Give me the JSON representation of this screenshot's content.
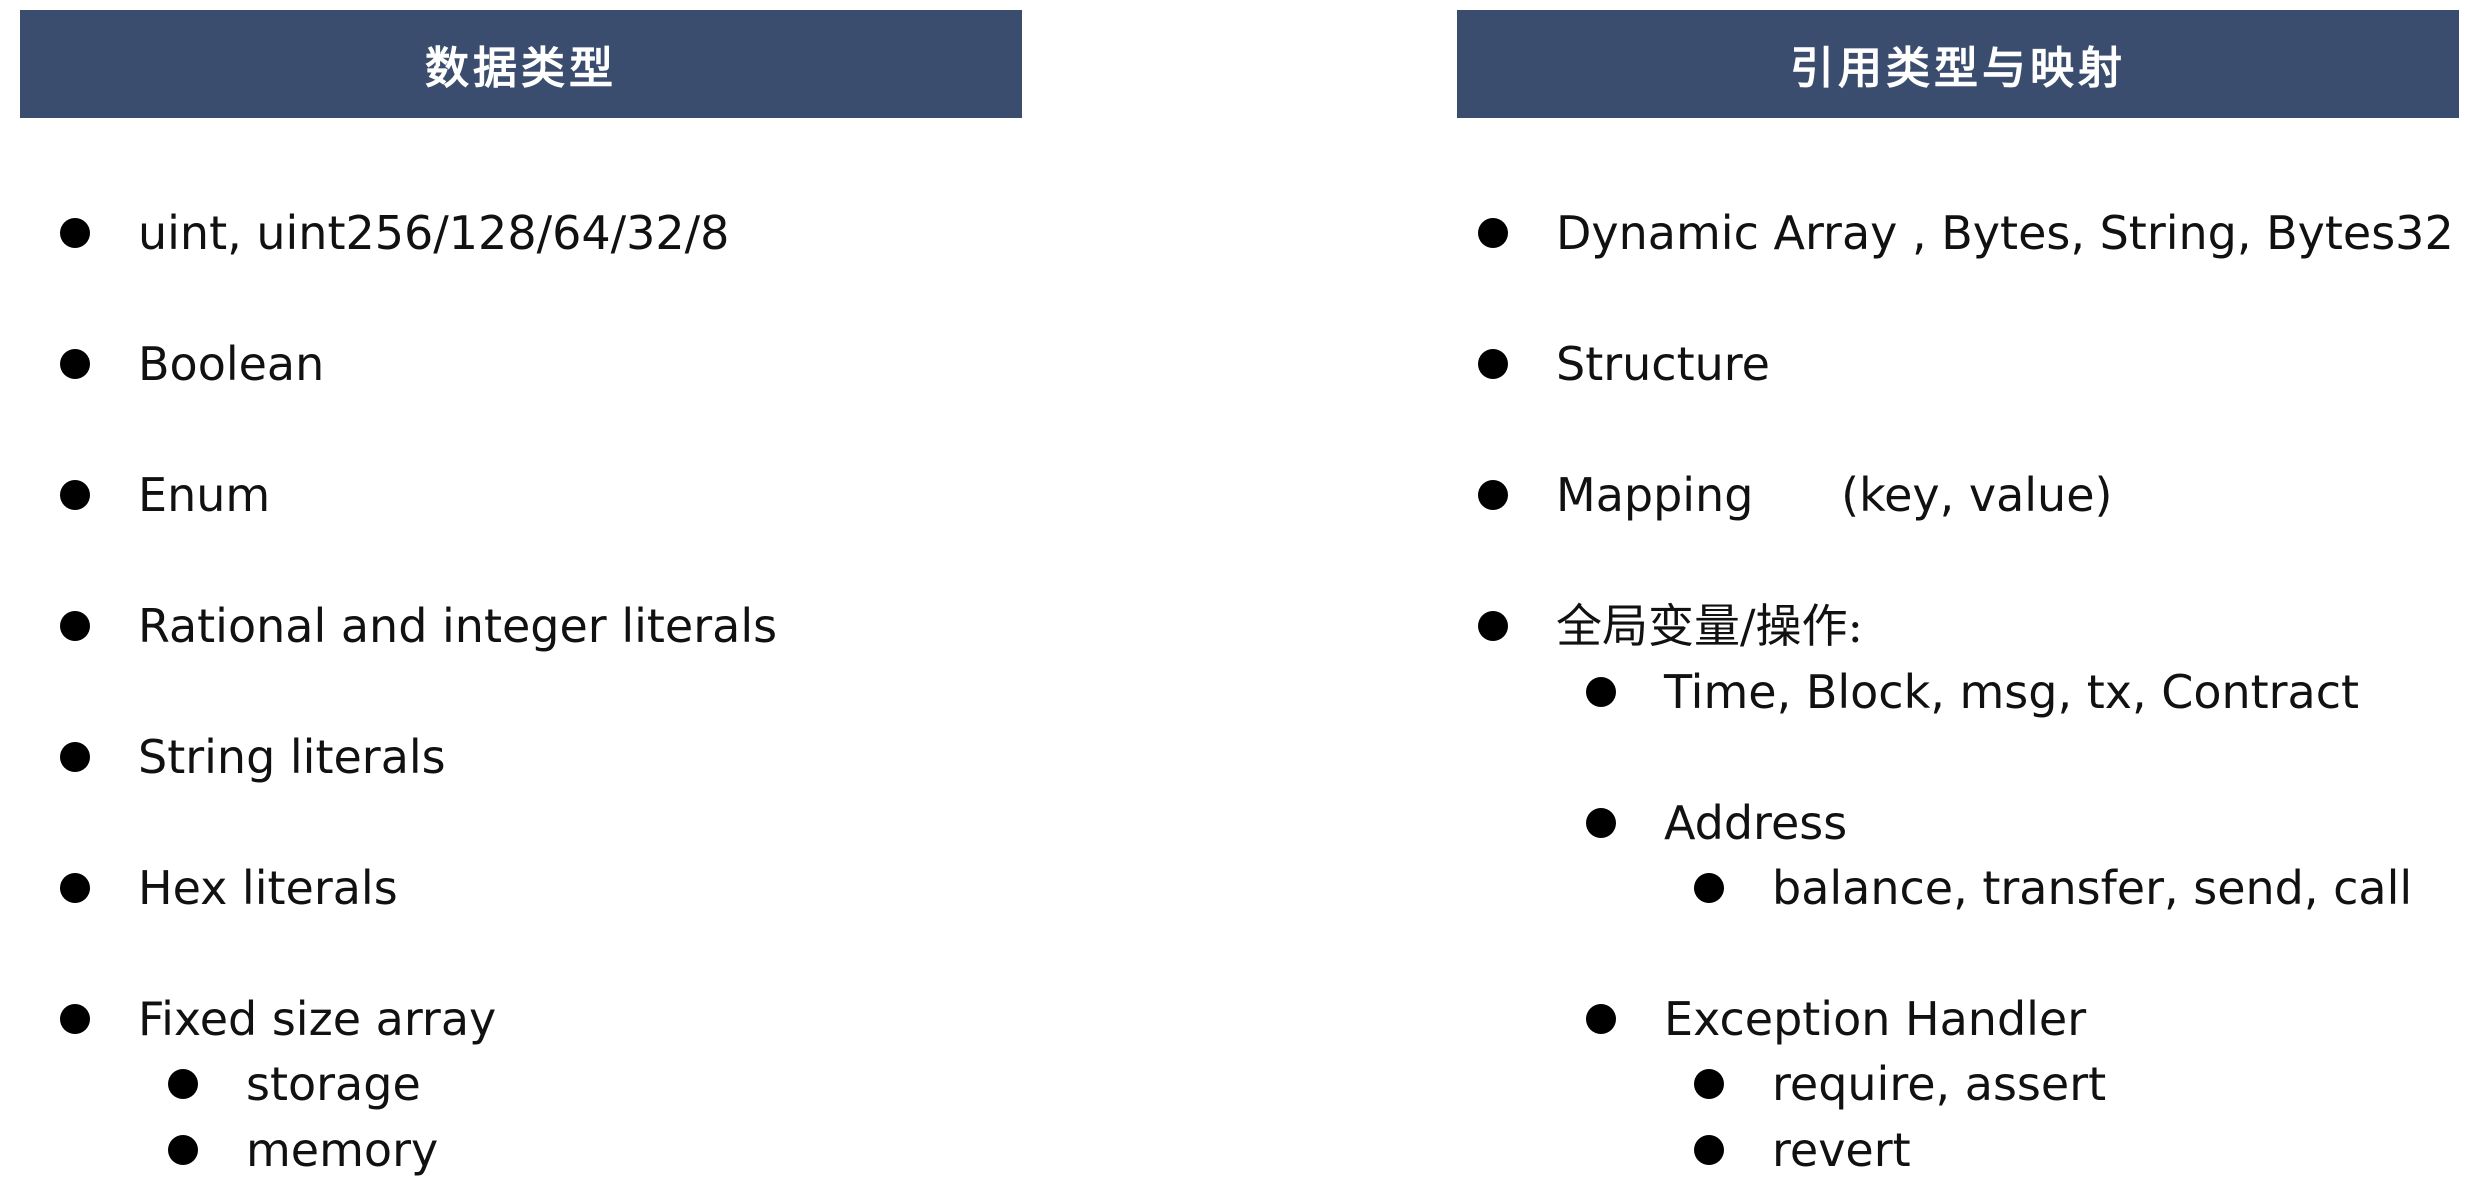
{
  "left": {
    "header": "数据类型",
    "items": [
      {
        "label": "uint, uint256/128/64/32/8",
        "level": 1
      },
      {
        "label": "Boolean",
        "level": 1
      },
      {
        "label": "Enum",
        "level": 1
      },
      {
        "label": "Rational and integer literals",
        "level": 1
      },
      {
        "label": "String literals",
        "level": 1
      },
      {
        "label": "Hex literals",
        "level": 1
      },
      {
        "label": "Fixed size array",
        "level": 1
      },
      {
        "label": "storage",
        "level": 2
      },
      {
        "label": "memory",
        "level": 2
      }
    ]
  },
  "right": {
    "header": "引用类型与映射",
    "items": [
      {
        "label": "Dynamic Array , Bytes, String, Bytes32",
        "level": 1
      },
      {
        "label": "Structure",
        "level": 1
      },
      {
        "label": "Mapping      (key, value)",
        "level": 1
      },
      {
        "label": "全局变量/操作:",
        "level": 1
      },
      {
        "label": "Time, Block, msg, tx, Contract",
        "level": 2
      },
      {
        "label": "Address",
        "level": 2
      },
      {
        "label": "balance, transfer, send, call",
        "level": 3
      },
      {
        "label": "Exception Handler",
        "level": 2
      },
      {
        "label": "require, assert",
        "level": 3
      },
      {
        "label": "revert",
        "level": 3
      }
    ]
  },
  "colors": {
    "header_bg": "#3a4d6e",
    "header_text": "#ffffff",
    "body_text": "#111111"
  }
}
